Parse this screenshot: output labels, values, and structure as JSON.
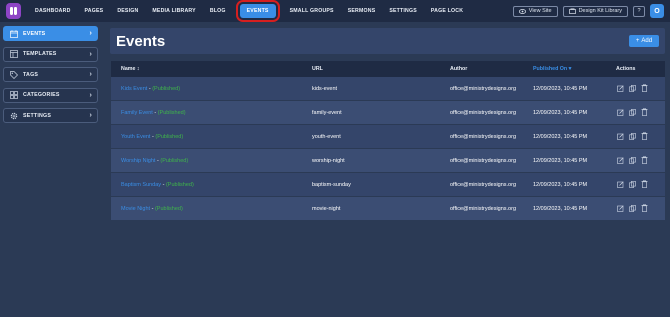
{
  "nav": {
    "items": [
      "DASHBOARD",
      "PAGES",
      "DESIGN",
      "MEDIA LIBRARY",
      "BLOG",
      "EVENTS",
      "SMALL GROUPS",
      "SERMONS",
      "SETTINGS",
      "PAGE LOCK"
    ],
    "active": "EVENTS",
    "view_site": "View Site",
    "design_kit": "Design Kit Library",
    "help": "?",
    "avatar": "O"
  },
  "sidebar": {
    "items": [
      {
        "label": "EVENTS",
        "icon": "calendar-icon",
        "active": true
      },
      {
        "label": "TEMPLATES",
        "icon": "template-icon",
        "active": false
      },
      {
        "label": "TAGS",
        "icon": "tag-icon",
        "active": false
      },
      {
        "label": "CATEGORIES",
        "icon": "grid-icon",
        "active": false
      },
      {
        "label": "SETTINGS",
        "icon": "gear-icon",
        "active": false
      }
    ]
  },
  "main": {
    "title": "Events",
    "add_label": "Add"
  },
  "table": {
    "columns": [
      "Name",
      "URL",
      "Author",
      "Published On",
      "Actions"
    ],
    "rows": [
      {
        "name": "Kids Event",
        "status": "(Published)",
        "url": "kids-event",
        "author": "office@ministrydesigns.org",
        "published": "12/09/2023, 10:45 PM"
      },
      {
        "name": "Family Event",
        "status": "(Published)",
        "url": "family-event",
        "author": "office@ministrydesigns.org",
        "published": "12/09/2023, 10:45 PM"
      },
      {
        "name": "Youth Event",
        "status": "(Published)",
        "url": "youth-event",
        "author": "office@ministrydesigns.org",
        "published": "12/09/2023, 10:45 PM"
      },
      {
        "name": "Worship Night",
        "status": "(Published)",
        "url": "worship-night",
        "author": "office@ministrydesigns.org",
        "published": "12/09/2023, 10:45 PM"
      },
      {
        "name": "Baptism Sunday",
        "status": "(Published)",
        "url": "baptism-sunday",
        "author": "office@ministrydesigns.org",
        "published": "12/09/2023, 10:45 PM"
      },
      {
        "name": "Movie Night",
        "status": "(Published)",
        "url": "movie-night",
        "author": "office@ministrydesigns.org",
        "published": "12/09/2023, 10:45 PM"
      }
    ]
  },
  "colors": {
    "accent": "#3a8ee6",
    "published": "#3fb54a",
    "highlight": "#d61f1f",
    "logo": "#8e44c6"
  }
}
